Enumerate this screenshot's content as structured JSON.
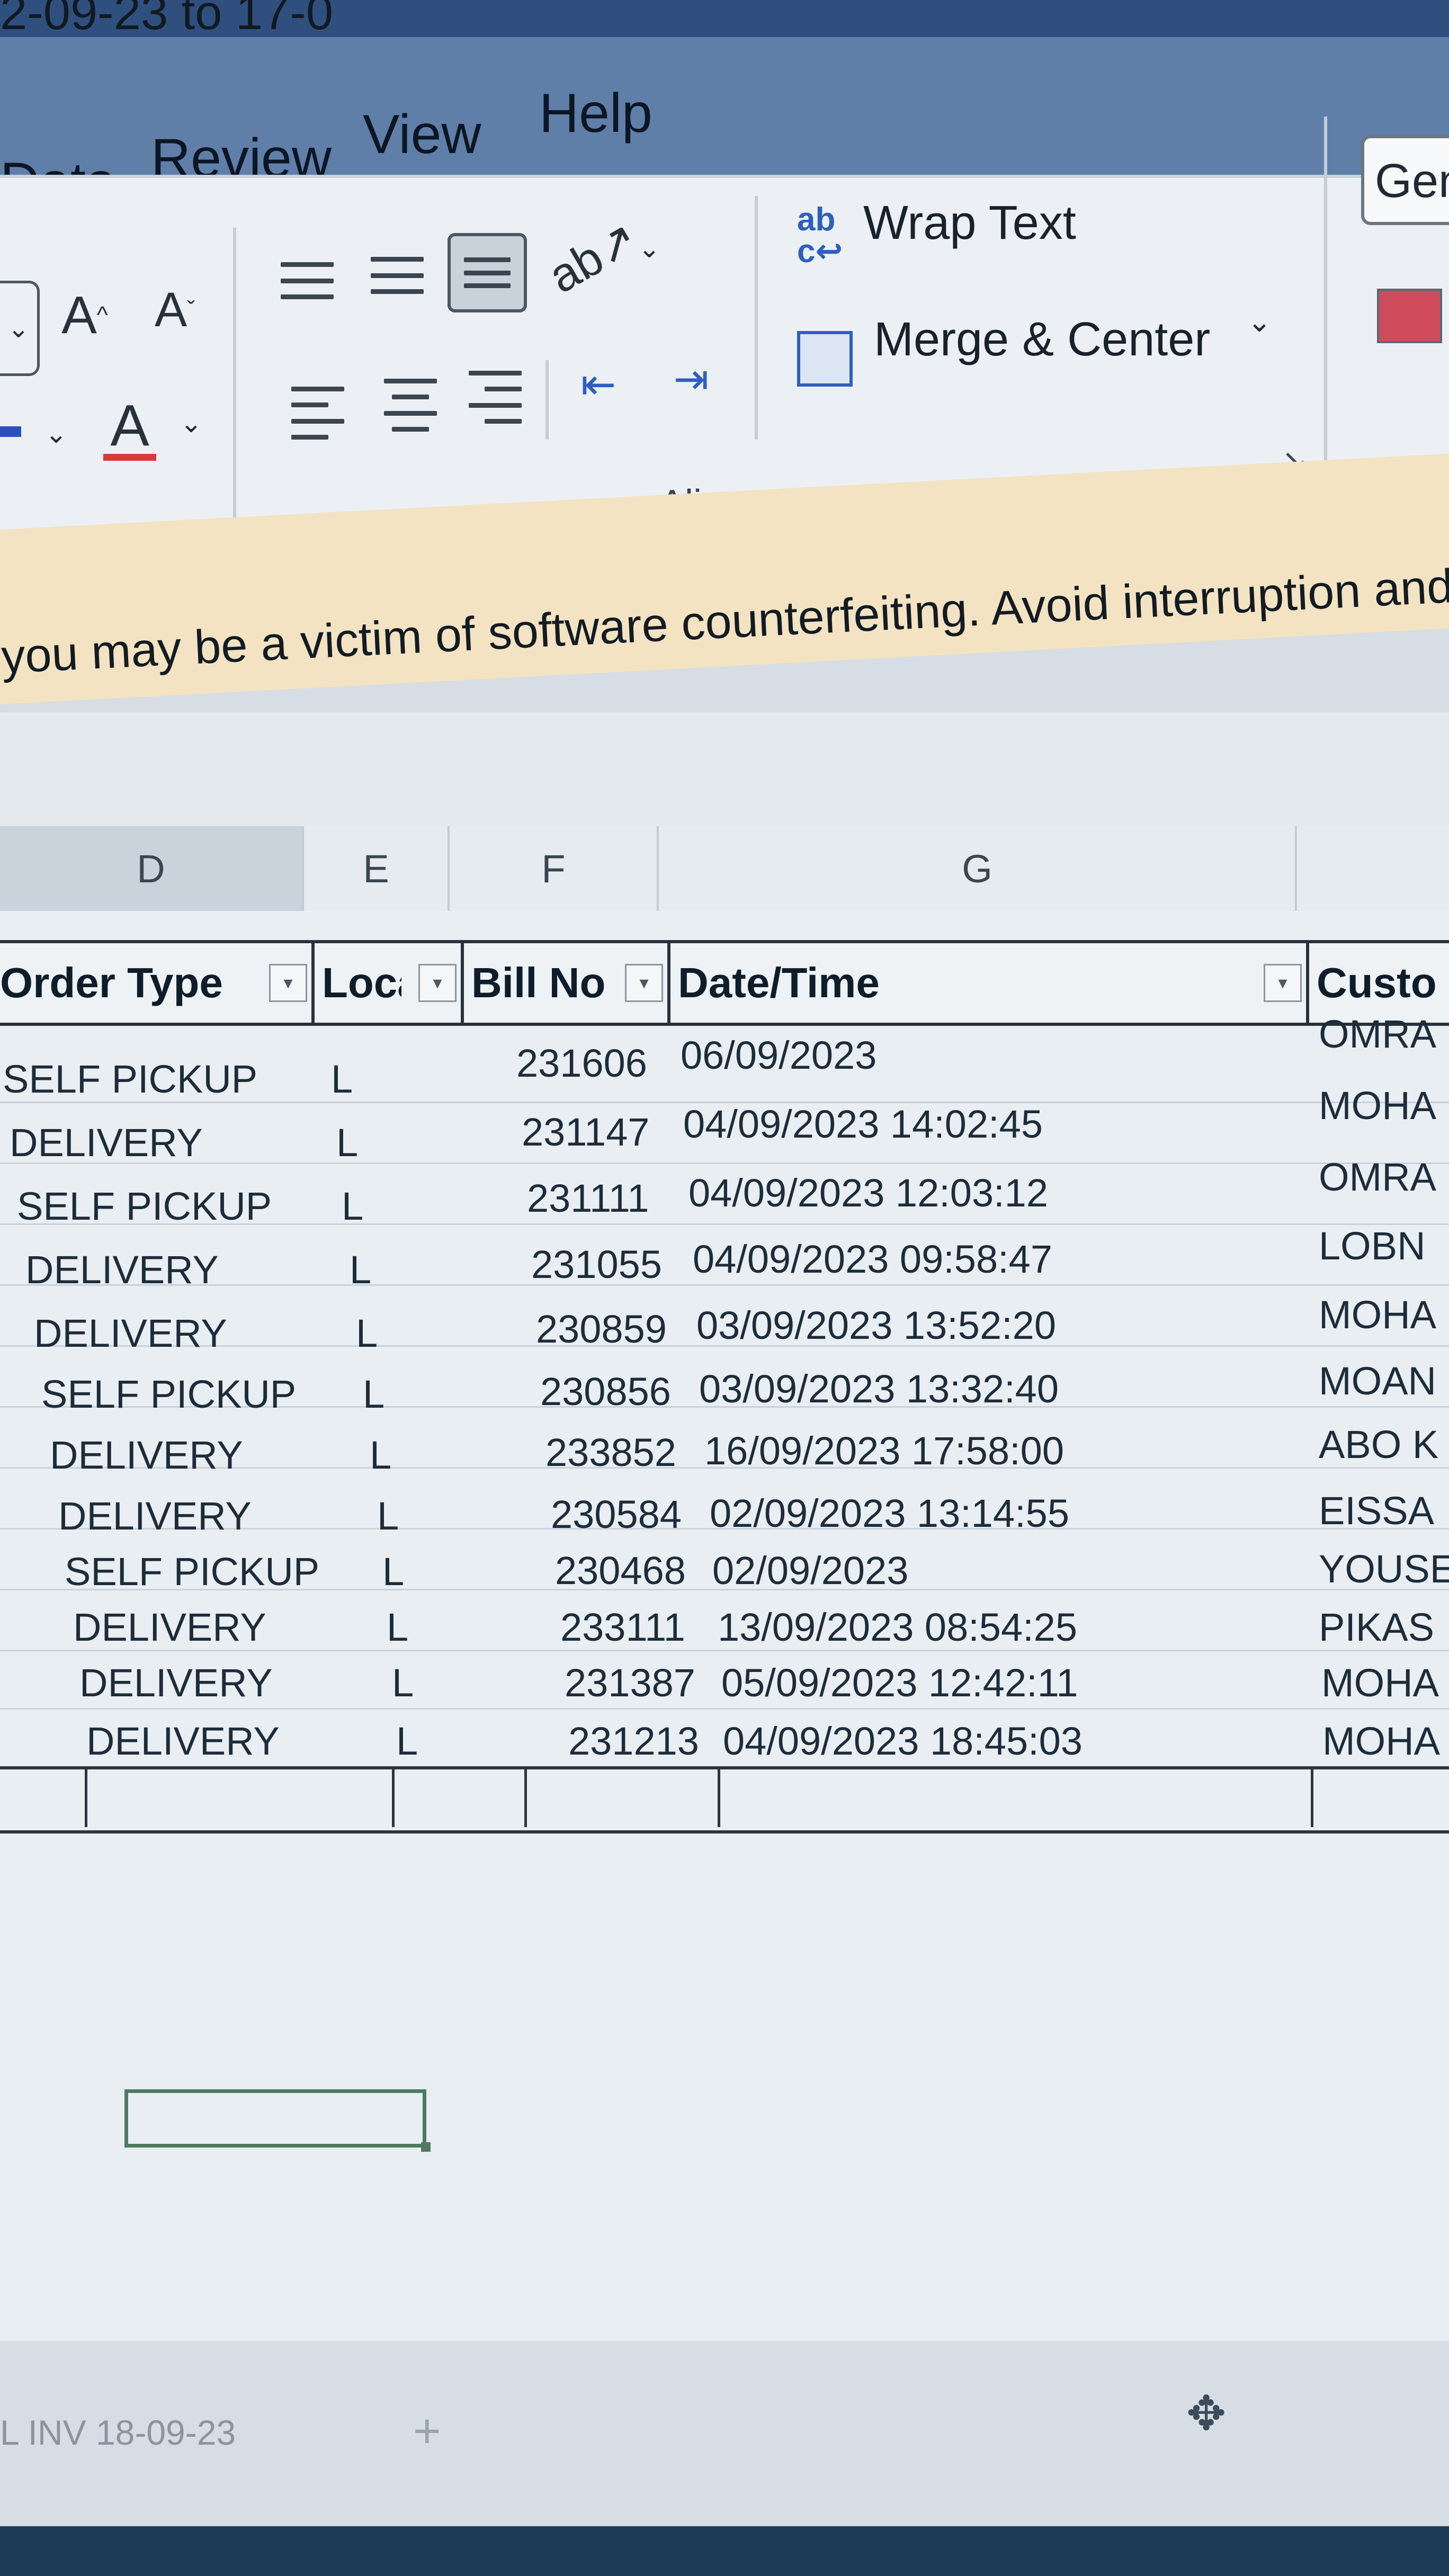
{
  "window": {
    "title": "2-09-23 to 17-0"
  },
  "menu": [
    "Data",
    "Review",
    "View",
    "Help"
  ],
  "ribbon": {
    "font_grow": "A",
    "font_shrink": "A",
    "font_color_glyph": "A",
    "wrap_text": "Wrap Text",
    "wrap_glyph": "ab",
    "merge_center": "Merge & Center",
    "group_label": "Alignment",
    "number_format": "Gen"
  },
  "warning": {
    "text": "you may be a victim of software counterfeiting. Avoid interruption and keep"
  },
  "columns": [
    "D",
    "E",
    "F",
    "G"
  ],
  "table": {
    "headers": [
      "Order Type",
      "Loca",
      "Bill No",
      "Date/Time",
      "Custo"
    ],
    "rows": [
      {
        "order_type": "SELF PICKUP",
        "loc": "L",
        "bill": "231606",
        "datetime": "06/09/2023",
        "customer": "OMRA"
      },
      {
        "order_type": "DELIVERY",
        "loc": "L",
        "bill": "231147",
        "datetime": "04/09/2023 14:02:45",
        "customer": "MOHA"
      },
      {
        "order_type": "SELF PICKUP",
        "loc": "L",
        "bill": "231111",
        "datetime": "04/09/2023 12:03:12",
        "customer": "OMRA"
      },
      {
        "order_type": "DELIVERY",
        "loc": "L",
        "bill": "231055",
        "datetime": "04/09/2023 09:58:47",
        "customer": "LOBN"
      },
      {
        "order_type": "DELIVERY",
        "loc": "L",
        "bill": "230859",
        "datetime": "03/09/2023 13:52:20",
        "customer": "MOHA"
      },
      {
        "order_type": "SELF PICKUP",
        "loc": "L",
        "bill": "230856",
        "datetime": "03/09/2023 13:32:40",
        "customer": "MOAN"
      },
      {
        "order_type": "DELIVERY",
        "loc": "L",
        "bill": "233852",
        "datetime": "16/09/2023 17:58:00",
        "customer": "ABO K"
      },
      {
        "order_type": "DELIVERY",
        "loc": "L",
        "bill": "230584",
        "datetime": "02/09/2023 13:14:55",
        "customer": "EISSA"
      },
      {
        "order_type": "SELF PICKUP",
        "loc": "L",
        "bill": "230468",
        "datetime": "02/09/2023",
        "customer": "YOUSE"
      },
      {
        "order_type": "DELIVERY",
        "loc": "L",
        "bill": "233111",
        "datetime": "13/09/2023 08:54:25",
        "customer": "PIKAS"
      },
      {
        "order_type": "DELIVERY",
        "loc": "L",
        "bill": "231387",
        "datetime": "05/09/2023 12:42:11",
        "customer": "MOHA"
      },
      {
        "order_type": "DELIVERY",
        "loc": "L",
        "bill": "231213",
        "datetime": "04/09/2023 18:45:03",
        "customer": "MOHA"
      }
    ]
  },
  "footer": {
    "sheet_tab": "L INV 18-09-23",
    "add_sheet": "+"
  }
}
